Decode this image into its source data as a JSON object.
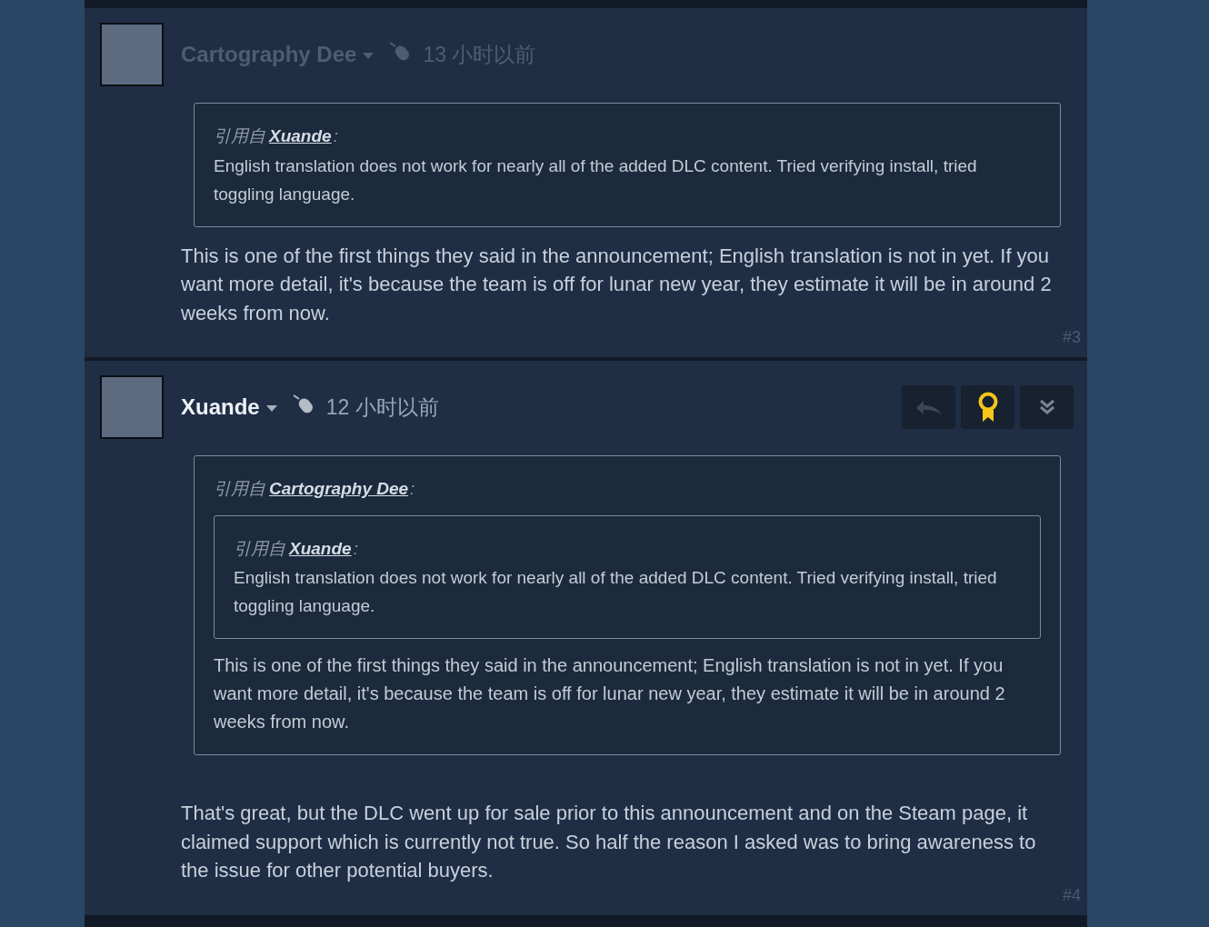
{
  "posts": [
    {
      "author": "Cartography Dee",
      "faded": true,
      "time": "13 小时以前",
      "actions_visible": false,
      "quote": {
        "prefix": "引用自",
        "author": "Xuande",
        "suffix": ":",
        "text": "English translation does not work for nearly all of the added DLC content. Tried verifying install, tried toggling language."
      },
      "body": "This is one of the first things they said in the announcement; English translation is not in yet. If you want more detail, it's because the team is off for lunar new year, they estimate it will be in around 2 weeks from now.",
      "number": "#3"
    },
    {
      "author": "Xuande",
      "faded": false,
      "time": "12 小时以前",
      "actions_visible": true,
      "quote": {
        "prefix": "引用自",
        "author": "Cartography Dee",
        "suffix": ":",
        "quote": {
          "prefix": "引用自",
          "author": "Xuande",
          "suffix": ":",
          "text": "English translation does not work for nearly all of the added DLC content. Tried verifying install, tried toggling language."
        },
        "text": "This is one of the first things they said in the announcement; English translation is not in yet. If you want more detail, it's because the team is off for lunar new year, they estimate it will be in around 2 weeks from now."
      },
      "body": "That's great, but the DLC went up for sale prior to this announcement and on the Steam page, it claimed support which is currently not true. So half the reason I asked was to bring awareness to the issue for other potential buyers.",
      "number": "#4"
    }
  ]
}
